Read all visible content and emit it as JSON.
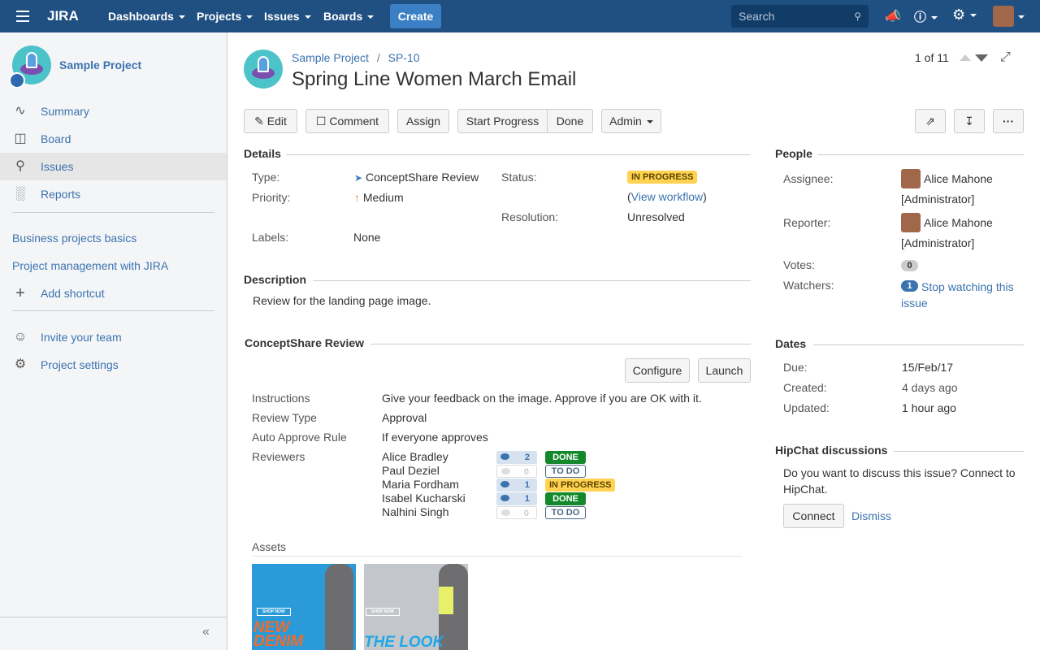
{
  "header": {
    "logo": "JIRA",
    "nav": [
      "Dashboards",
      "Projects",
      "Issues",
      "Boards"
    ],
    "create": "Create",
    "search_placeholder": "Search"
  },
  "sidebar": {
    "project": "Sample Project",
    "items": [
      {
        "label": "Summary"
      },
      {
        "label": "Board"
      },
      {
        "label": "Issues"
      },
      {
        "label": "Reports"
      }
    ],
    "links": [
      "Business projects basics",
      "Project management with JIRA"
    ],
    "add_shortcut": "Add shortcut",
    "invite": "Invite your team",
    "settings": "Project settings"
  },
  "issue": {
    "breadcrumb_project": "Sample Project",
    "breadcrumb_sep": "/",
    "key": "SP-10",
    "title": "Spring Line Women March Email",
    "pager": "1 of 11"
  },
  "toolbar": {
    "edit": "Edit",
    "comment": "Comment",
    "assign": "Assign",
    "start": "Start Progress",
    "done": "Done",
    "admin": "Admin"
  },
  "details": {
    "heading": "Details",
    "type_label": "Type:",
    "type": "ConceptShare Review",
    "priority_label": "Priority:",
    "priority": "Medium",
    "labels_label": "Labels:",
    "labels": "None",
    "status_label": "Status:",
    "status": "IN PROGRESS",
    "workflow_open": "(",
    "workflow": "View workflow",
    "workflow_close": ")",
    "resolution_label": "Resolution:",
    "resolution": "Unresolved"
  },
  "description": {
    "heading": "Description",
    "text": "Review for the landing page image."
  },
  "conceptshare": {
    "heading": "ConceptShare Review",
    "configure": "Configure",
    "launch": "Launch",
    "instructions_label": "Instructions",
    "instructions": "Give your feedback on the image. Approve if you are OK with it.",
    "type_label": "Review Type",
    "type": "Approval",
    "rule_label": "Auto Approve Rule",
    "rule": "If everyone approves",
    "reviewers_label": "Reviewers",
    "reviewers": [
      {
        "name": "Alice Bradley",
        "comments": "2",
        "status": "DONE"
      },
      {
        "name": "Paul Deziel",
        "comments": "0",
        "status": "TO DO"
      },
      {
        "name": "Maria Fordham",
        "comments": "1",
        "status": "IN PROGRESS"
      },
      {
        "name": "Isabel Kucharski",
        "comments": "1",
        "status": "DONE"
      },
      {
        "name": "Nalhini Singh",
        "comments": "0",
        "status": "TO DO"
      }
    ],
    "assets_label": "Assets",
    "assets": [
      {
        "headline": "NEW DENIM",
        "cta": "SHOP NOW"
      },
      {
        "headline": "THE LOOK",
        "cta": "SHOP NOW"
      }
    ]
  },
  "people": {
    "heading": "People",
    "assignee_label": "Assignee:",
    "assignee": "Alice Mahone",
    "assignee_role": "[Administrator]",
    "reporter_label": "Reporter:",
    "reporter": "Alice Mahone",
    "reporter_role": "[Administrator]",
    "votes_label": "Votes:",
    "votes": "0",
    "watchers_label": "Watchers:",
    "watchers": "1",
    "watch_link": "Stop watching this issue"
  },
  "dates": {
    "heading": "Dates",
    "due_label": "Due:",
    "due": "15/Feb/17",
    "created_label": "Created:",
    "created": "4 days ago",
    "updated_label": "Updated:",
    "updated": "1 hour ago"
  },
  "hipchat": {
    "heading": "HipChat discussions",
    "text": "Do you want to discuss this issue? Connect to HipChat.",
    "connect": "Connect",
    "dismiss": "Dismiss"
  }
}
